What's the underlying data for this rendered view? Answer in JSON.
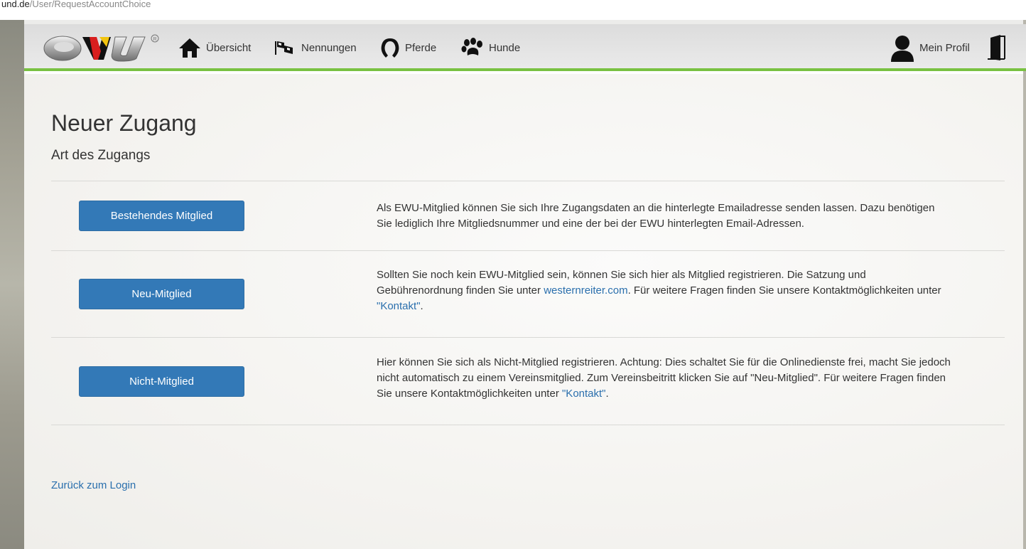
{
  "browser": {
    "url_domain": "und.de",
    "url_path": "/User/RequestAccountChoice"
  },
  "nav": {
    "logo_text": "EWU",
    "items": [
      {
        "label": "Übersicht",
        "icon": "home-icon"
      },
      {
        "label": "Nennungen",
        "icon": "flag-icon"
      },
      {
        "label": "Pferde",
        "icon": "horseshoe-icon"
      },
      {
        "label": "Hunde",
        "icon": "paw-icon"
      }
    ],
    "profile_label": "Mein Profil",
    "profile_icon": "user-icon",
    "logout_icon": "door-icon"
  },
  "page": {
    "title": "Neuer Zugang",
    "subtitle": "Art des Zugangs",
    "options": [
      {
        "button": "Bestehendes Mitglied",
        "text_1": "Als EWU-Mitglied können Sie sich Ihre Zugangsdaten an die hinterlegte Emailadresse senden lassen. Dazu benötigen Sie lediglich Ihre Mitgliedsnummer und eine der bei der EWU hinterlegten Email-Adressen."
      },
      {
        "button": "Neu-Mitglied",
        "text_1": "Sollten Sie noch kein EWU-Mitglied sein, können Sie sich hier als Mitglied registrieren. Die Satzung und Gebührenordnung finden Sie unter ",
        "link_1": "westernreiter.com",
        "text_2": ". Für weitere Fragen finden Sie unsere Kontaktmöglichkeiten unter ",
        "link_2": "\"Kontakt\"",
        "text_3": "."
      },
      {
        "button": "Nicht-Mitglied",
        "text_1": "Hier können Sie sich als Nicht-Mitglied registrieren. Achtung: Dies schaltet Sie für die Onlinedienste frei, macht Sie jedoch nicht automatisch zu einem Vereinsmitglied. Zum Vereinsbeitritt klicken Sie auf \"Neu-Mitglied\". Für weitere Fragen finden Sie unsere Kontaktmöglichkeiten unter ",
        "link_2": "\"Kontakt\"",
        "text_3": "."
      }
    ],
    "back_link": "Zurück zum Login"
  },
  "colors": {
    "accent_green": "#79c142",
    "button_blue": "#3379b7",
    "link_blue": "#2a6fad"
  }
}
